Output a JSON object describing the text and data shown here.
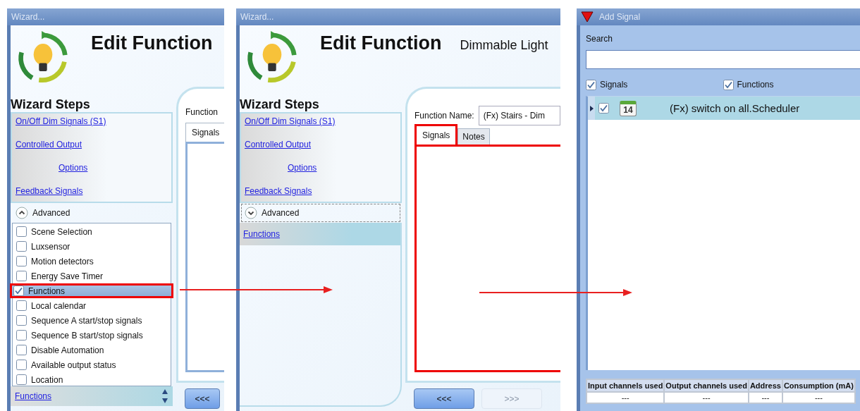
{
  "wizard_before": {
    "title": "Wizard...",
    "heading": "Edit Function",
    "steps_title": "Wizard Steps",
    "step_links": [
      {
        "label": "On/Off Dim Signals (S1)",
        "indented": false
      },
      {
        "label": "Controlled Output",
        "indented": false
      },
      {
        "label": "Options",
        "indented": true
      },
      {
        "label": "Feedback Signals",
        "indented": false
      }
    ],
    "advanced": {
      "label": "Advanced",
      "expanded": true,
      "focused": false
    },
    "options": [
      {
        "label": "Scene Selection",
        "checked": false,
        "selected": false,
        "highlighted": false
      },
      {
        "label": "Luxsensor",
        "checked": false,
        "selected": false,
        "highlighted": false
      },
      {
        "label": "Motion detectors",
        "checked": false,
        "selected": false,
        "highlighted": false
      },
      {
        "label": "Energy Save Timer",
        "checked": false,
        "selected": false,
        "highlighted": false
      },
      {
        "label": "Functions",
        "checked": true,
        "selected": true,
        "highlighted": true
      },
      {
        "label": "Local calendar",
        "checked": false,
        "selected": false,
        "highlighted": false
      },
      {
        "label": "Sequence A start/stop signals",
        "checked": false,
        "selected": false,
        "highlighted": false
      },
      {
        "label": "Sequence B start/stop signals",
        "checked": false,
        "selected": false,
        "highlighted": false
      },
      {
        "label": "Disable Automation",
        "checked": false,
        "selected": false,
        "highlighted": false
      },
      {
        "label": "Available output status",
        "checked": false,
        "selected": false,
        "highlighted": false
      },
      {
        "label": "Location",
        "checked": false,
        "selected": false,
        "highlighted": false
      }
    ],
    "current_step": "Functions",
    "function_label": "Function",
    "tabs": [
      {
        "label": "Signals",
        "selected": true
      }
    ],
    "back_button": "<<<"
  },
  "wizard_after": {
    "title": "Wizard...",
    "heading": "Edit Function",
    "subtitle": "Dimmable Light",
    "steps_title": "Wizard Steps",
    "step_links": [
      {
        "label": "On/Off Dim Signals (S1)",
        "indented": false
      },
      {
        "label": "Controlled Output",
        "indented": false
      },
      {
        "label": "Options",
        "indented": true
      },
      {
        "label": "Feedback Signals",
        "indented": false
      }
    ],
    "advanced": {
      "label": "Advanced",
      "expanded": false,
      "focused": true
    },
    "active_step": {
      "label": "Functions",
      "selected": true
    },
    "function_name_label": "Function Name:",
    "function_name_value": "(Fx) Stairs - Dim",
    "tabs": [
      {
        "label": "Signals",
        "selected": true,
        "highlighted": true
      },
      {
        "label": "Notes",
        "selected": false,
        "highlighted": false
      }
    ],
    "buttons": [
      {
        "label": "<<<",
        "disabled": false
      },
      {
        "label": ">>>",
        "disabled": true
      }
    ]
  },
  "add_signal": {
    "title": "Add Signal",
    "search_label": "Search",
    "filters": [
      {
        "label": "Signals",
        "checked": true
      },
      {
        "label": "Functions",
        "checked": true
      }
    ],
    "rows": [
      {
        "label": "(Fx) switch on all.Scheduler",
        "calendar_day": "14",
        "checked": true,
        "selected": true
      }
    ],
    "table": {
      "columns": [
        "Input channels used",
        "Output channels used",
        "Address",
        "Consumption (mA)"
      ],
      "rows": [
        [
          "---",
          "---",
          "---",
          "---"
        ]
      ]
    }
  }
}
